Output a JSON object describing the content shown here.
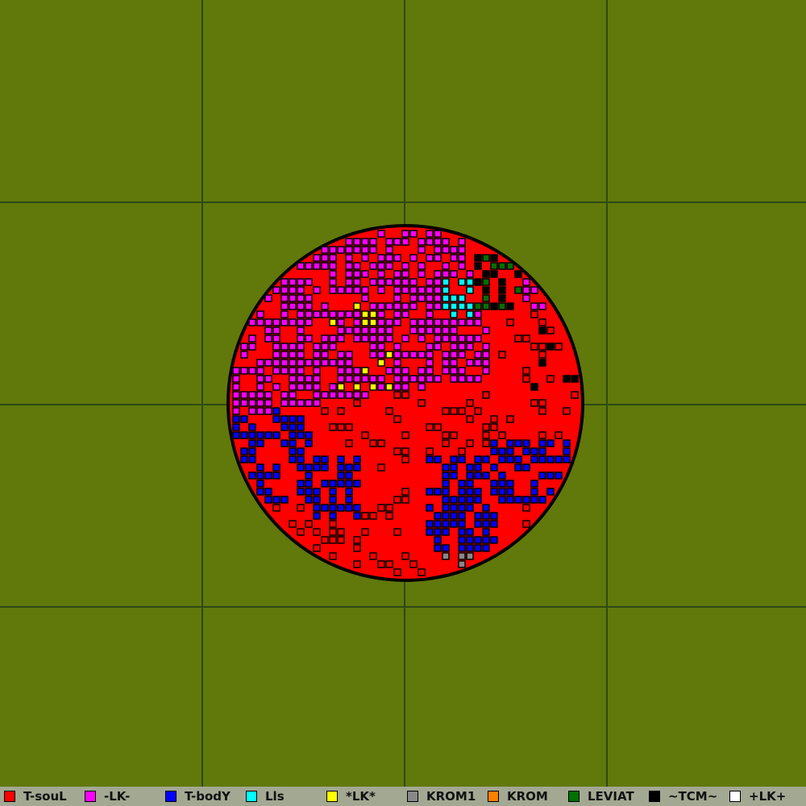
{
  "map": {
    "background": "#61780b",
    "grid_color": "#2d4a12",
    "grid_cells": 4,
    "planet_fill": "#ff0000",
    "planet_outline": "#000000"
  },
  "legend": {
    "players": [
      {
        "name": "T-souL",
        "color": "#ff0000"
      },
      {
        "name": "-LK-",
        "color": "#ff00ff"
      },
      {
        "name": "T-bodY",
        "color": "#0000ff"
      },
      {
        "name": "Lls",
        "color": "#00ffff"
      },
      {
        "name": "*LK*",
        "color": "#ffff00"
      },
      {
        "name": "KROM1",
        "color": "#888888"
      },
      {
        "name": "KROM",
        "color": "#ff8000"
      },
      {
        "name": "LEVIAT",
        "color": "#007000"
      },
      {
        "name": "~TCM~",
        "color": "#000000"
      },
      {
        "name": "+LK+",
        "color": "#ffffff"
      }
    ]
  }
}
